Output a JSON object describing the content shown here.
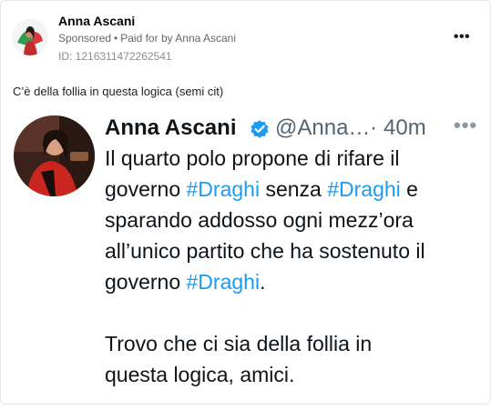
{
  "ad": {
    "page_name": "Anna Ascani",
    "sponsored_label": "Sponsored",
    "paid_for_label": "Paid for by Anna Ascani",
    "ad_id": "ID: 1216311472262541",
    "more_icon": "more-horizontal-icon",
    "post_text": "C’è della follia in questa logica (semi cit)"
  },
  "tweet": {
    "name": "Anna Ascani",
    "handle": "@Anna…",
    "separator": "·",
    "time": "40m",
    "line1": "Il quarto polo propone di rifare il",
    "line2_a": "governo ",
    "line2_tag": "#Draghi",
    "line2_b": " senza ",
    "line2_tag2": "#Draghi",
    "line2_c": " e",
    "line3": "sparando addosso ogni mezz’ora",
    "line4": "all’unico partito che ha sostenuto il",
    "line5_a": "governo ",
    "line5_tag": "#Draghi",
    "line5_b": ".",
    "line6": "Trovo che ci sia della follia in",
    "line7": "questa logica, amici."
  },
  "colors": {
    "hashtag": "#1d9bf0",
    "verified": "#1d9bf0",
    "secondary_text": "#65676b",
    "tweet_secondary": "#536471"
  }
}
